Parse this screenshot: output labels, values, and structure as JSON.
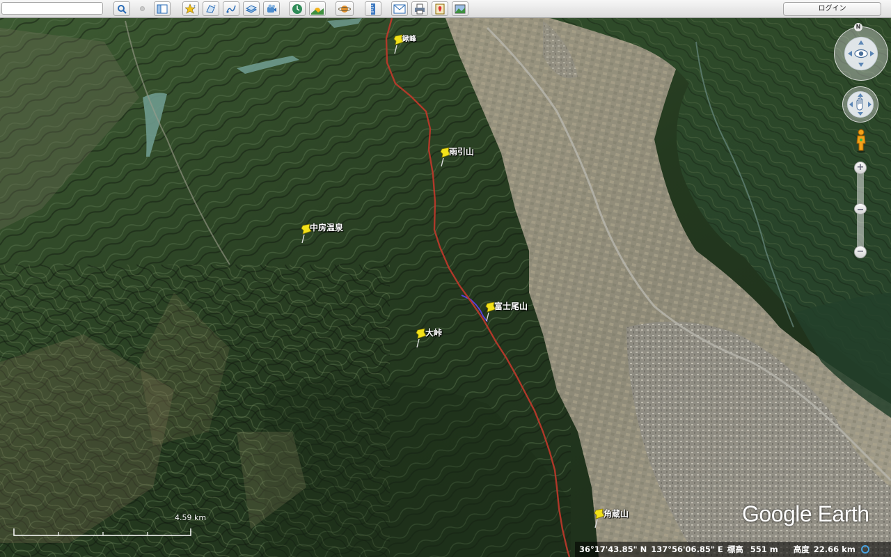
{
  "toolbar": {
    "search_value": "",
    "buttons": [
      {
        "name": "search-icon"
      },
      {
        "name": "sidebar-toggle-icon"
      },
      {
        "name": "add-placemark-icon"
      },
      {
        "name": "add-polygon-icon"
      },
      {
        "name": "add-path-icon"
      },
      {
        "name": "add-image-overlay-icon"
      },
      {
        "name": "record-tour-icon"
      },
      {
        "name": "historical-imagery-icon"
      },
      {
        "name": "sunlight-icon"
      },
      {
        "name": "planets-icon"
      },
      {
        "name": "ruler-icon"
      },
      {
        "name": "email-icon"
      },
      {
        "name": "print-icon"
      },
      {
        "name": "view-in-maps-icon"
      },
      {
        "name": "save-image-icon"
      }
    ],
    "login_label": "ログイン"
  },
  "map": {
    "placemarks": [
      {
        "label": "鍬峰"
      },
      {
        "label": "雨引山"
      },
      {
        "label": "中房温泉"
      },
      {
        "label": "富士尾山"
      },
      {
        "label": "大峠"
      },
      {
        "label": "角蔵山"
      }
    ],
    "colors": {
      "route": "#c0392b",
      "short_path": "#5a3fe0",
      "pin": "#f2e21a"
    }
  },
  "navigation": {
    "north_label": "N"
  },
  "scale": {
    "label": "4.59 km"
  },
  "logo": {
    "text": "Google Earth"
  },
  "status": {
    "latitude": "36°17'43.85\" N",
    "longitude": "137°56'06.85\" E",
    "elevation_label": "標高",
    "elevation_value": "551 m",
    "altitude_label": "高度",
    "altitude_value": "22.66 km"
  }
}
